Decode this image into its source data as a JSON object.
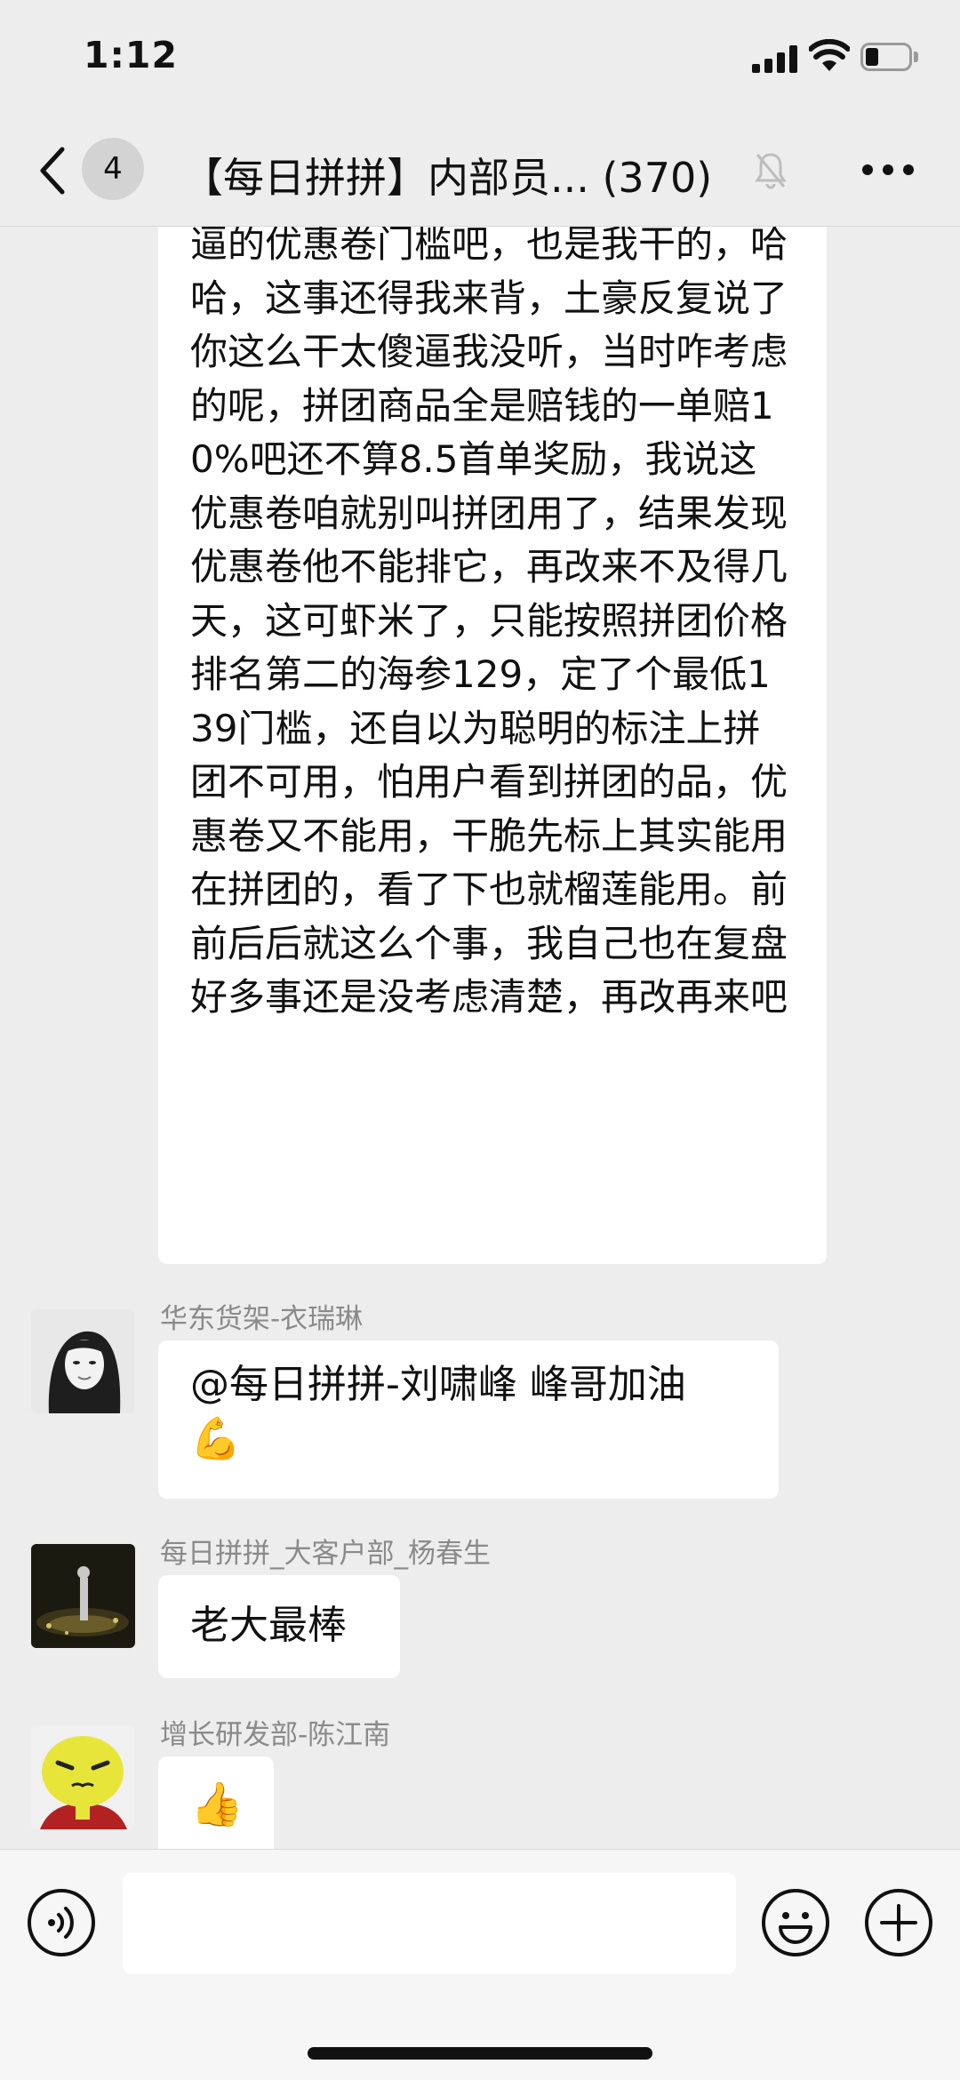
{
  "status_bar": {
    "time": "1:12"
  },
  "nav": {
    "back_icon": "chevron-left-icon",
    "unread_badge": "4",
    "title": "【每日拼拼】内部员... (370)",
    "muted_icon": "bell-off-icon",
    "more_icon": "ellipsis-icon"
  },
  "messages": [
    {
      "sender": "",
      "text": "逼的优惠卷门槛吧，也是我干的，哈哈，这事还得我来背，土豪反复说了你这么干太傻逼我没听，当时咋考虑的呢，拼团商品全是赔钱的一单赔10%吧还不算8.5首单奖励，我说这优惠卷咱就别叫拼团用了，结果发现优惠卷他不能排它，再改来不及得几天，这可虾米了，只能按照拼团价格排名第二的海参129，定了个最低139门槛，还自以为聪明的标注上拼团不可用，怕用户看到拼团的品，优惠卷又不能用，干脆先标上其实能用在拼团的，看了下也就榴莲能用。前前后后就这么个事，我自己也在复盘好多事还是没考虑清楚，再改再来吧"
    },
    {
      "sender": "华东货架-衣瑞琳",
      "text": "@每日拼拼-刘啸峰 峰哥加油",
      "emoji": "💪"
    },
    {
      "sender": "每日拼拼_大客户部_杨春生",
      "text": "老大最棒"
    },
    {
      "sender": "增长研发部-陈江南",
      "emoji": "👍"
    }
  ],
  "input_bar": {
    "voice_icon": "voice-icon",
    "emoji_icon": "emoji-icon",
    "plus_icon": "plus-icon"
  }
}
